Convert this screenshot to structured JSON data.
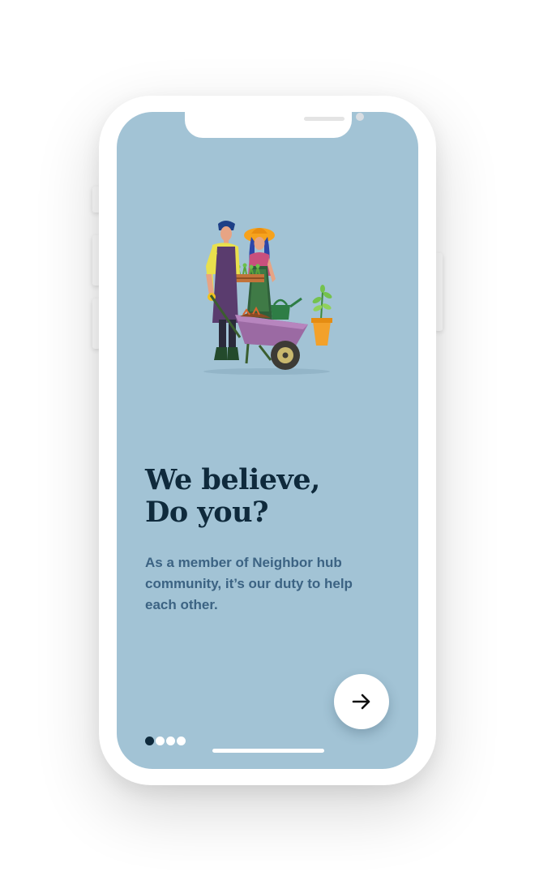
{
  "onboarding": {
    "headline_line1": "We believe,",
    "headline_line2": "Do you?",
    "body": "As a member of Neighbor hub community, it’s our duty to help each other."
  },
  "navigation": {
    "next_icon": "arrow-right-icon",
    "page_count": 4,
    "active_page": 1
  },
  "illustration": {
    "subject": "gardeners-with-wheelbarrow"
  },
  "colors": {
    "screen_background": "#a2c3d5",
    "headline": "#0f2a3c",
    "body_text": "#3c6383",
    "accent_dark": "#0f2a3c",
    "button_background": "#ffffff"
  }
}
